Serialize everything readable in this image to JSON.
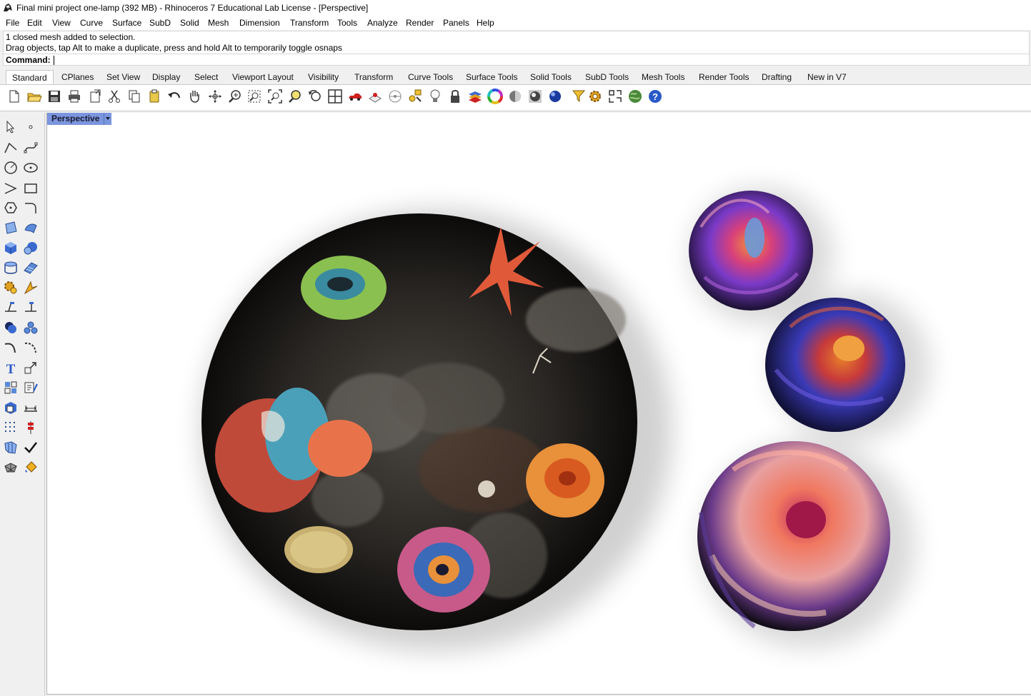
{
  "window": {
    "title": "Final mini project one-lamp (392 MB) - Rhinoceros 7 Educational Lab License - [Perspective]"
  },
  "menu": {
    "items": [
      "File",
      "Edit",
      "View",
      "Curve",
      "Surface",
      "SubD",
      "Solid",
      "Mesh",
      "Dimension",
      "Transform",
      "Tools",
      "Analyze",
      "Render",
      "Panels",
      "Help"
    ]
  },
  "command_area": {
    "history": [
      "1 closed mesh added to selection.",
      "Drag objects, tap Alt to make a duplicate, press and hold Alt to temporarily toggle osnaps"
    ],
    "prompt": "Command:",
    "value": ""
  },
  "toolbar_tabs": {
    "active": "Standard",
    "items": [
      "Standard",
      "CPlanes",
      "Set View",
      "Display",
      "Select",
      "Viewport Layout",
      "Visibility",
      "Transform",
      "Curve Tools",
      "Surface Tools",
      "Solid Tools",
      "SubD Tools",
      "Mesh Tools",
      "Render Tools",
      "Drafting",
      "New in V7"
    ]
  },
  "toolbar_icons": [
    "new-file-icon",
    "open-file-icon",
    "save-icon",
    "print-icon",
    "import-icon",
    "cut-icon",
    "copy-icon",
    "paste-icon",
    "undo-icon",
    "pan-hand-icon",
    "rotate-view-icon",
    "zoom-dynamic-icon",
    "zoom-window-icon",
    "zoom-extents-icon",
    "zoom-selected-icon",
    "undo-view-icon",
    "four-viewports-icon",
    "car-icon",
    "grid-snap-icon",
    "cplane-icon",
    "select-filter-icon",
    "light-icon",
    "lock-icon",
    "layer-icon",
    "color-wheel-icon",
    "shaded-sphere-icon",
    "rendered-sphere-icon",
    "render-sphere-icon",
    "blue-sphere-icon",
    "properties-icon",
    "options-gear-icon",
    "tool-grid-icon",
    "globe-icon",
    "help-icon"
  ],
  "sidebar_icons": [
    "select-arrow-icon",
    "point-icon",
    "polyline-icon",
    "curve-control-icon",
    "circle-icon",
    "ellipse-icon",
    "arc-icon",
    "rectangle-icon",
    "polygon-icon",
    "fillet-curve-icon",
    "surface-points-icon",
    "surface-loft-icon",
    "box-icon",
    "sphere-icon",
    "cylinder-icon",
    "mesh-plane-icon",
    "gear-icon",
    "explode-icon",
    "trim-icon",
    "split-icon",
    "boolean-union-icon",
    "group-icon",
    "fillet-edge-icon",
    "blend-curve-icon",
    "text-icon",
    "scale-icon",
    "array-icon",
    "align-icon",
    "block-icon",
    "dimension-icon",
    "grid-array-icon",
    "distribute-icon",
    "cage-edit-icon",
    "check-icon",
    "mesh-object-icon",
    "paint-bucket-icon"
  ],
  "viewport": {
    "label": "Perspective",
    "objects": [
      {
        "name": "large-reef-disc",
        "description_colors": [
          "#1a1816",
          "#3c3a36",
          "#c75a4a",
          "#4aa0b8",
          "#e8a040"
        ]
      },
      {
        "name": "small-flower-disc-top",
        "description_colors": [
          "#2a1838",
          "#d84a7a",
          "#7a4ac8",
          "#e8783a"
        ]
      },
      {
        "name": "small-flower-disc-middle",
        "description_colors": [
          "#18183a",
          "#4a48c0",
          "#c84a2a",
          "#e88a3a"
        ]
      },
      {
        "name": "flower-disc-bottom",
        "description_colors": [
          "#1a1420",
          "#e86a5a",
          "#f0a0a0",
          "#c83a6a"
        ]
      }
    ]
  }
}
